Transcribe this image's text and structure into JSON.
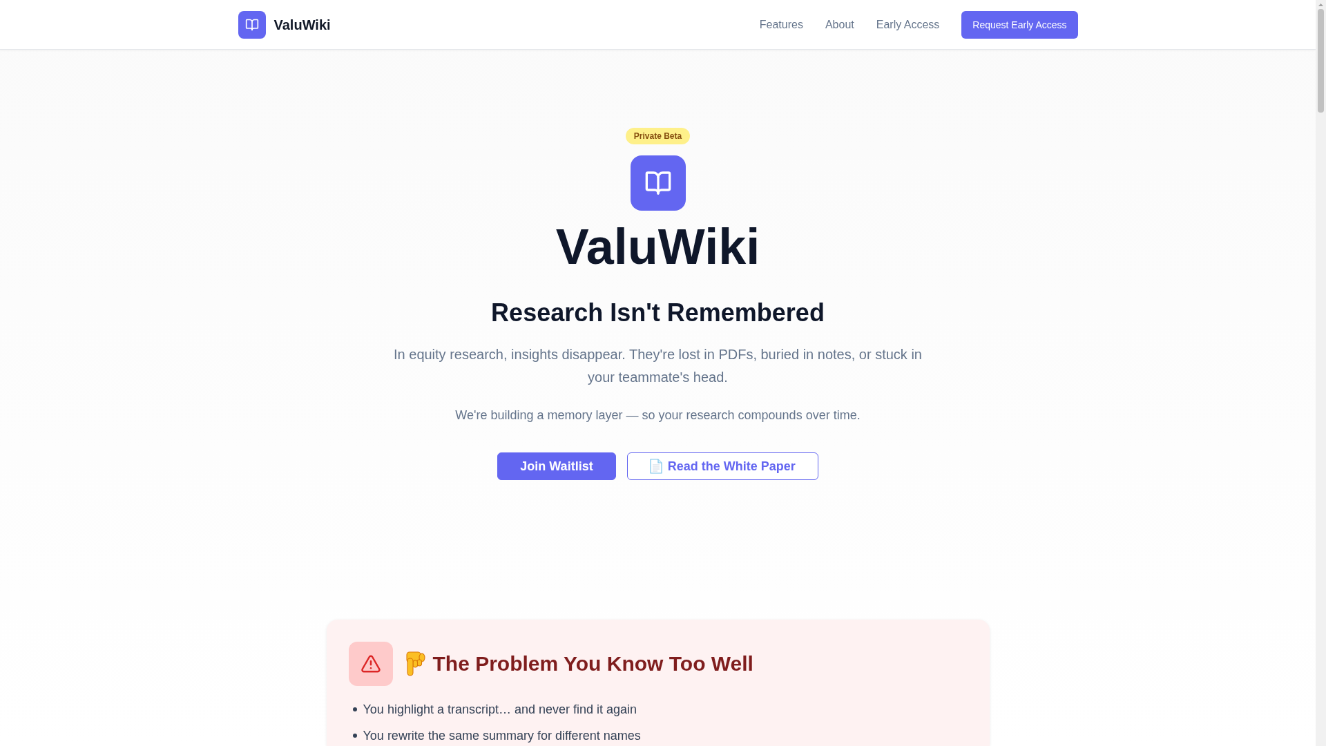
{
  "navbar": {
    "brand": "ValuWiki",
    "links": [
      "Features",
      "About",
      "Early Access"
    ],
    "cta": "Request Early Access"
  },
  "hero": {
    "badge": "Private Beta",
    "title": "ValuWiki",
    "headline": "Research Isn't Remembered",
    "description": "In equity research, insights disappear. They're lost in PDFs, buried in notes, or stuck in your teammate's head.",
    "tagline": "We're building a memory layer — so your research compounds over time.",
    "buttons": [
      {
        "label": "Join Waitlist",
        "kind": "primary"
      },
      {
        "label": "Read the White Paper",
        "kind": "outline"
      }
    ]
  },
  "problem_card": {
    "heading": "The Problem You Know Too Well",
    "items": [
      "You highlight a transcript… and never find it again",
      "You rewrite the same summary for different names"
    ]
  }
}
